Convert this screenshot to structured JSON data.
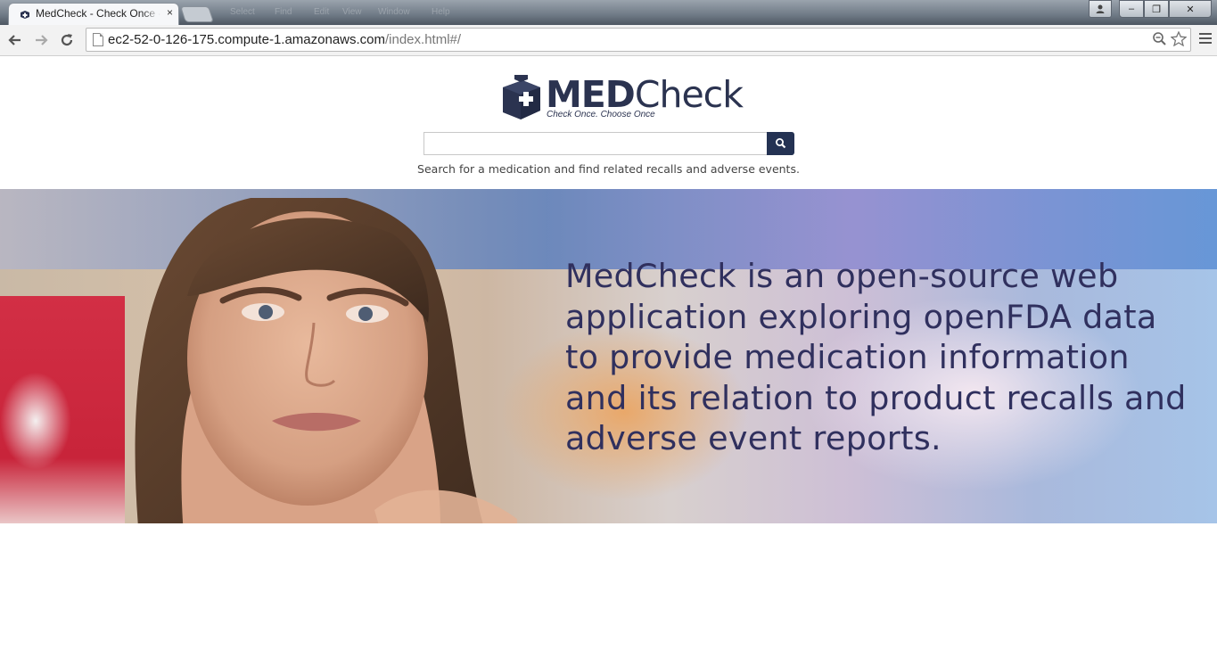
{
  "browser": {
    "tab_title": "MedCheck - Check Once - Choose Once",
    "tab_close": "×",
    "menu_ghost": [
      "Select",
      "Find",
      "Edit",
      "View",
      "Window",
      "Help"
    ],
    "url_host": "ec2-52-0-126-175.compute-1.amazonaws.com",
    "url_path": "/index.html#/",
    "window_buttons": {
      "minimize": "–",
      "maximize": "❐",
      "close": "✕"
    }
  },
  "page": {
    "logo_bold": "MED",
    "logo_light": "Check",
    "tagline": "Check Once. Choose Once",
    "search": {
      "value": "",
      "placeholder": ""
    },
    "search_help": "Search for a medication and find related recalls and adverse events.",
    "hero_text": "MedCheck is an open-source web application exploring openFDA data to provide medication information and its relation to product recalls and adverse event reports."
  },
  "colors": {
    "brand_navy": "#2b3350",
    "search_button": "#243253",
    "hero_text": "#30305e"
  },
  "icons": [
    "back-icon",
    "forward-icon",
    "reload-icon",
    "page-icon",
    "zoom-icon",
    "star-icon",
    "menu-icon",
    "search-icon",
    "user-icon"
  ]
}
